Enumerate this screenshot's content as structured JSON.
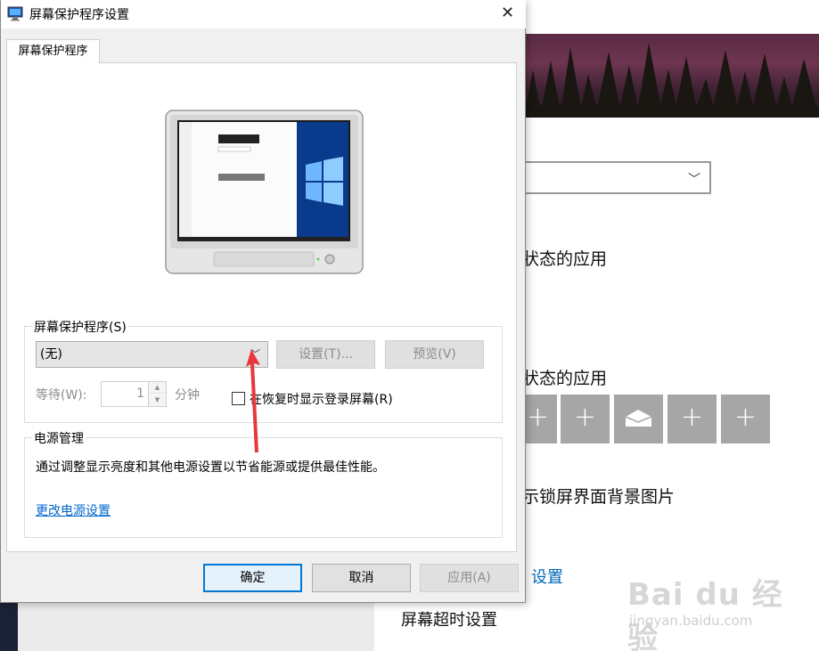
{
  "dialog": {
    "title": "屏幕保护程序设置",
    "close_glyph": "✕",
    "tab_label": "屏幕保护程序",
    "saver_group": {
      "title": "屏幕保护程序(S)",
      "selected": "(无)",
      "settings_label": "设置(T)...",
      "preview_label": "预览(V)",
      "wait_label": "等待(W):",
      "wait_value": "1",
      "wait_unit": "分钟",
      "resume_label": "在恢复时显示登录屏幕(R)",
      "resume_checked": false
    },
    "power_group": {
      "title": "电源管理",
      "description": "通过调整显示亮度和其他电源设置以节省能源或提供最佳性能。",
      "link": "更改电源设置"
    },
    "buttons": {
      "ok": "确定",
      "cancel": "取消",
      "apply": "应用(A)"
    }
  },
  "background": {
    "text1": "状态的应用",
    "text2": "状态的应用",
    "text3": "示锁屏界面背景图片",
    "link": "设置",
    "timeout": "屏幕超时设置",
    "tiles": [
      "+",
      "+",
      "mail-icon",
      "+",
      "+"
    ]
  },
  "watermark": {
    "logo": "Bai du 经验",
    "sub": "jingyan.baidu.com"
  },
  "colors": {
    "accent": "#0078d7",
    "link": "#0066cc",
    "arrow": "#e8383d",
    "tile": "#a6a6a6"
  }
}
